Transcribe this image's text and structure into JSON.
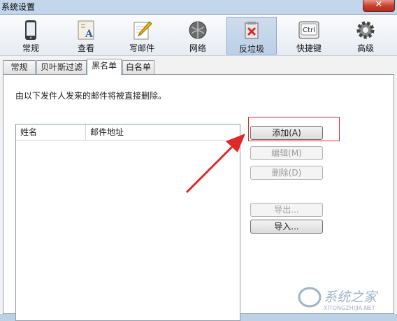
{
  "window": {
    "title": "系统设置",
    "close_glyph": "✕"
  },
  "toolbar": {
    "items": [
      {
        "label": "常规",
        "icon": "phone-icon"
      },
      {
        "label": "查看",
        "icon": "view-icon"
      },
      {
        "label": "写邮件",
        "icon": "write-mail-icon"
      },
      {
        "label": "网络",
        "icon": "network-icon"
      },
      {
        "label": "反垃圾",
        "icon": "anti-spam-icon",
        "active": true
      },
      {
        "label": "快捷键",
        "icon": "shortcut-key-icon"
      },
      {
        "label": "高级",
        "icon": "gear-icon"
      }
    ],
    "ctrl_text": "Ctrl"
  },
  "tabs": [
    {
      "label": "常规"
    },
    {
      "label": "贝叶斯过滤"
    },
    {
      "label": "黑名单",
      "selected": true
    },
    {
      "label": "白名单"
    }
  ],
  "blacklist": {
    "description": "由以下发件人发来的邮件将被直接删除。",
    "columns": [
      "姓名",
      "邮件地址"
    ],
    "rows": []
  },
  "buttons": {
    "add": "添加(A)",
    "edit": "编辑(M)",
    "delete": "删除(D)",
    "export": "导出...",
    "import": "导入..."
  },
  "watermark": {
    "text": "系统之家",
    "url": "XITONGZHIJIA.NET"
  },
  "colors": {
    "highlight": "#e0282a",
    "arrow": "#e0282a"
  }
}
